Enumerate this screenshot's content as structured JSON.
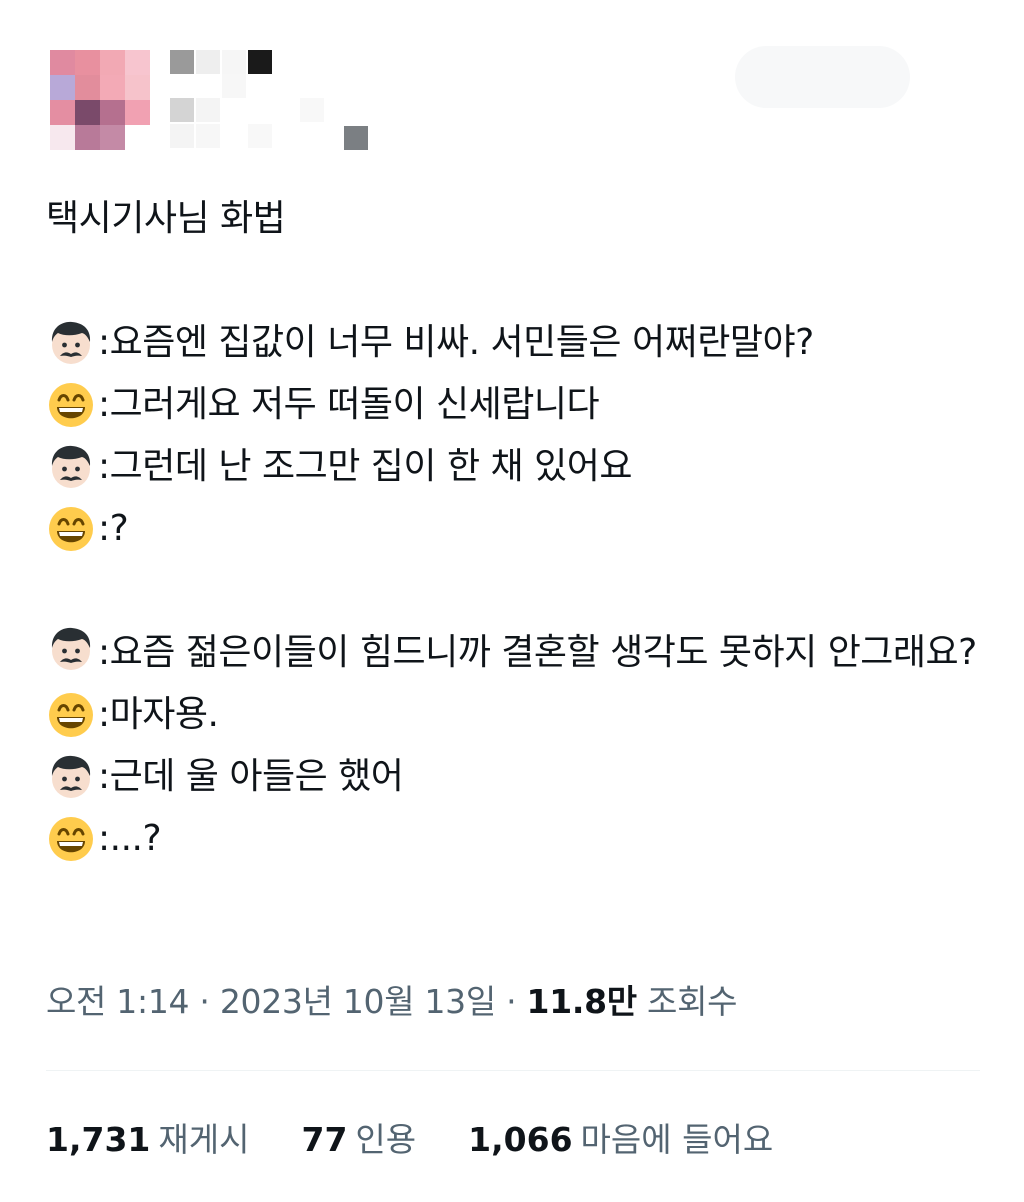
{
  "tweet": {
    "title": "택시기사님 화법",
    "section1": [
      {
        "speaker": "driver",
        "text": ":요즘엔 집값이 너무 비싸. 서민들은 어쩌란말야?"
      },
      {
        "speaker": "passenger",
        "text": ":그러게요 저두 떠돌이 신세랍니다"
      },
      {
        "speaker": "driver",
        "text": ":그런데 난 조그만 집이 한 채 있어요"
      },
      {
        "speaker": "passenger",
        "text": ":?"
      }
    ],
    "section2": [
      {
        "speaker": "driver",
        "text": ":요즘 젊은이들이 힘드니까 결혼할 생각도 못하지 안그래요?"
      },
      {
        "speaker": "passenger",
        "text": ":마자용."
      },
      {
        "speaker": "driver",
        "text": ":근데 울 아들은 했어"
      },
      {
        "speaker": "passenger",
        "text": ":...?"
      }
    ]
  },
  "meta": {
    "time": "오전 1:14",
    "date": "2023년 10월 13일",
    "views_count": "11.8만",
    "views_label": "조회수"
  },
  "stats": {
    "reposts_count": "1,731",
    "reposts_label": "재게시",
    "quotes_count": "77",
    "quotes_label": "인용",
    "likes_count": "1,066",
    "likes_label": "마음에 들어요"
  },
  "icons": {
    "driver": "man-with-mustache-icon",
    "passenger": "grinning-face-icon"
  },
  "colors": {
    "text": "#0f1419",
    "secondary": "#536471",
    "divider": "#eff3f4"
  }
}
